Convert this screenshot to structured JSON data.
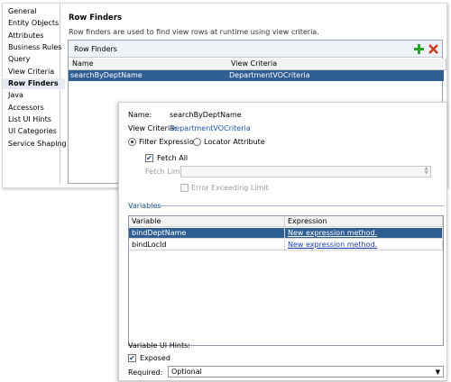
{
  "nav": {
    "items": [
      "General",
      "Entity Objects",
      "Attributes",
      "Business Rules",
      "Query",
      "View Criteria",
      "Row Finders",
      "Java",
      "Accessors",
      "List UI Hints",
      "UI Categories",
      "Service Shaping"
    ],
    "selected": "Row Finders"
  },
  "row_finders": {
    "title": "Row Finders",
    "description": "Row finders are used to find view rows at runtime using view criteria.",
    "panel_label": "Row Finders",
    "columns": [
      "Name",
      "View Criteria"
    ],
    "rows": [
      {
        "name": "searchByDeptName",
        "view_criteria": "DepartmentVOCriteria"
      }
    ],
    "add_icon": "plus-icon",
    "delete_icon": "delete-x-icon"
  },
  "details": {
    "name_label": "Name:",
    "name_value": "searchByDeptName",
    "vc_label": "View Criteria:",
    "vc_value": "DepartmentVOCriteria",
    "filter_expression": "Filter Expression",
    "locator_attribute": "Locator Attribute",
    "fetch_all": "Fetch All",
    "fetch_limit_label": "Fetch Limit:",
    "error_exceeding": "Error Exceeding Limit",
    "variables_label": "Variables",
    "var_columns": [
      "Variable",
      "Expression"
    ],
    "variables": [
      {
        "variable": "bindDeptName",
        "expression": "New expression method."
      },
      {
        "variable": "bindLocId",
        "expression": "New expression method."
      }
    ],
    "ui_hints_label": "Variable UI Hints:",
    "exposed": "Exposed",
    "required_label": "Required:",
    "required_value": "Optional"
  },
  "colors": {
    "selection": "#2f5e93",
    "link": "#1a3eb1",
    "add": "#2e9e2e",
    "delete": "#d23a1e"
  }
}
